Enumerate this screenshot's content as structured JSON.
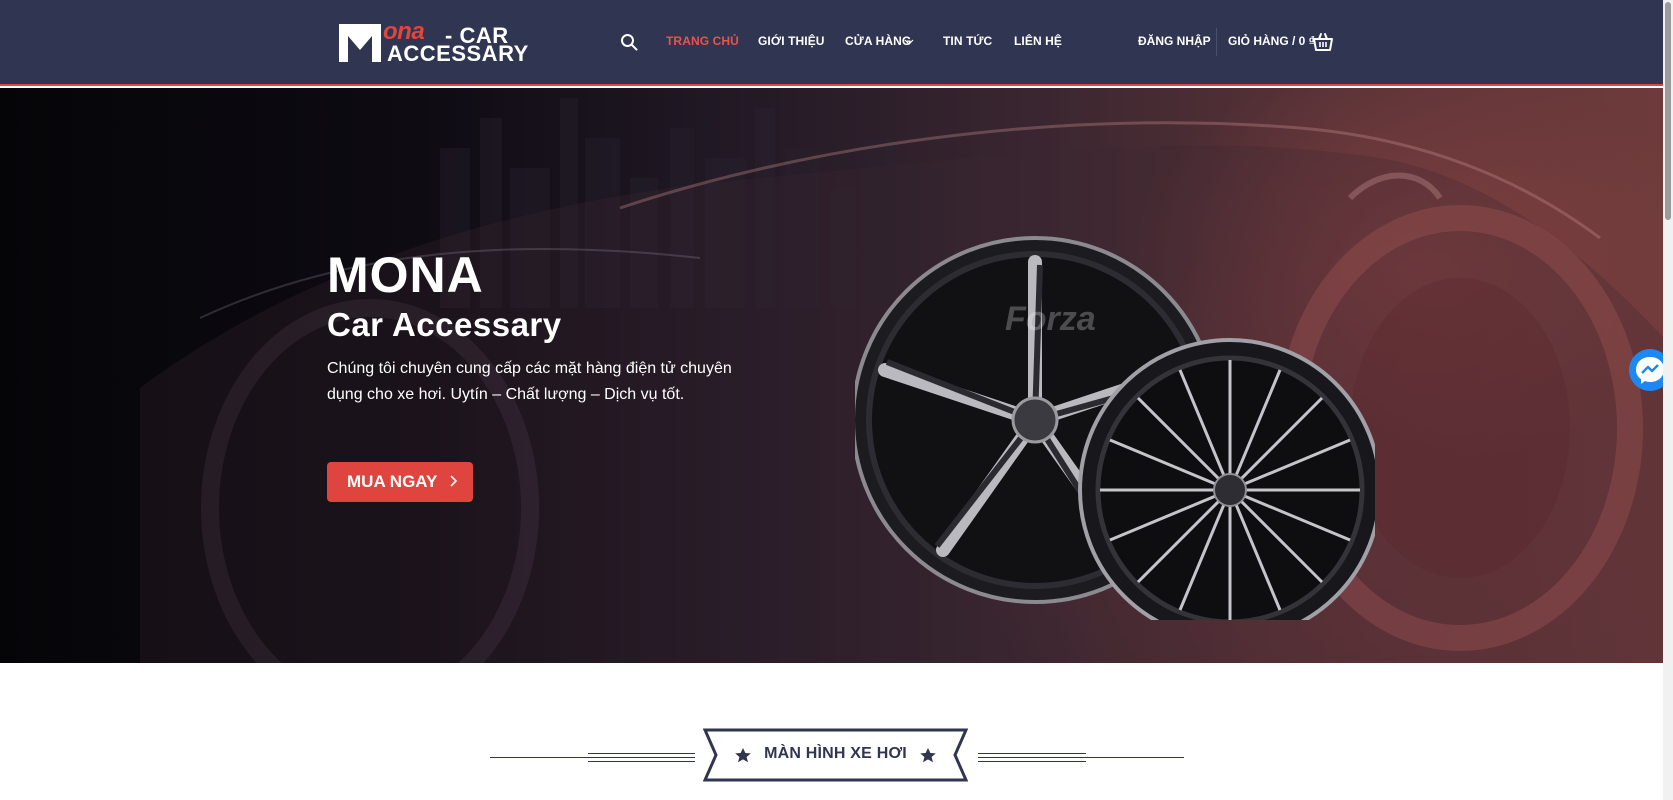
{
  "logo": {
    "brand": "ona",
    "line1": "- CAR",
    "line2": "ACCESSARY"
  },
  "nav": {
    "items": [
      {
        "label": "TRANG CHỦ",
        "active": true
      },
      {
        "label": "GIỚI THIỆU",
        "active": false
      },
      {
        "label": "CỬA HÀNG",
        "active": false,
        "has_dropdown": true
      },
      {
        "label": "TIN TỨC",
        "active": false
      },
      {
        "label": "LIÊN HỆ",
        "active": false
      }
    ],
    "login": "ĐĂNG NHẬP",
    "cart": "GIỎ HÀNG / 0 ₫"
  },
  "hero": {
    "title": "MONA",
    "subtitle": "Car Accessary",
    "description": "Chúng tôi chuyên cung cấp các mặt hàng điện tử chuyên dụng cho xe hơi. Uytín – Chất lượng – Dịch vụ tốt.",
    "cta": "MUA NGAY",
    "wheel_brand": "Forza"
  },
  "section": {
    "title": "MÀN HÌNH XE HƠI"
  },
  "colors": {
    "header_bg": "#303552",
    "accent": "#e0443e",
    "active_nav": "#e8544b"
  },
  "icons": [
    "search-icon",
    "chevron-down-icon",
    "cart-icon",
    "chevron-right-icon",
    "messenger-icon",
    "star-icon"
  ]
}
